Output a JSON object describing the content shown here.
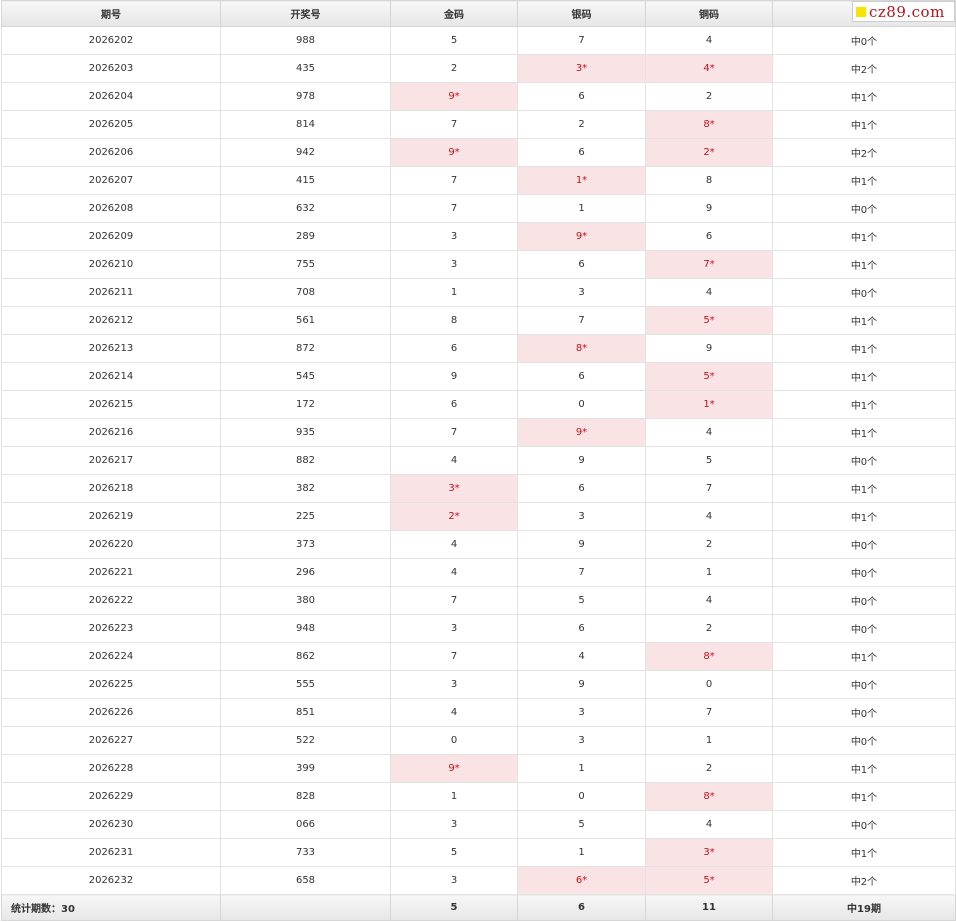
{
  "watermark": {
    "text": "cz89.com",
    "square_color": "#f4e600",
    "text_color": "#b3141d"
  },
  "colors": {
    "hit_background": "#f9e3e4",
    "hit_text": "#c0141e"
  },
  "table": {
    "headers": [
      "期号",
      "开奖号",
      "金码",
      "银码",
      "铜码",
      ""
    ],
    "rows": [
      {
        "issue": "2026202",
        "number": "988",
        "gold": "5",
        "silver": "7",
        "bronze": "4",
        "result": "中0个",
        "hits": []
      },
      {
        "issue": "2026203",
        "number": "435",
        "gold": "2",
        "silver": "3*",
        "bronze": "4*",
        "result": "中2个",
        "hits": [
          "silver",
          "bronze"
        ]
      },
      {
        "issue": "2026204",
        "number": "978",
        "gold": "9*",
        "silver": "6",
        "bronze": "2",
        "result": "中1个",
        "hits": [
          "gold"
        ]
      },
      {
        "issue": "2026205",
        "number": "814",
        "gold": "7",
        "silver": "2",
        "bronze": "8*",
        "result": "中1个",
        "hits": [
          "bronze"
        ]
      },
      {
        "issue": "2026206",
        "number": "942",
        "gold": "9*",
        "silver": "6",
        "bronze": "2*",
        "result": "中2个",
        "hits": [
          "gold",
          "bronze"
        ]
      },
      {
        "issue": "2026207",
        "number": "415",
        "gold": "7",
        "silver": "1*",
        "bronze": "8",
        "result": "中1个",
        "hits": [
          "silver"
        ]
      },
      {
        "issue": "2026208",
        "number": "632",
        "gold": "7",
        "silver": "1",
        "bronze": "9",
        "result": "中0个",
        "hits": []
      },
      {
        "issue": "2026209",
        "number": "289",
        "gold": "3",
        "silver": "9*",
        "bronze": "6",
        "result": "中1个",
        "hits": [
          "silver"
        ]
      },
      {
        "issue": "2026210",
        "number": "755",
        "gold": "3",
        "silver": "6",
        "bronze": "7*",
        "result": "中1个",
        "hits": [
          "bronze"
        ]
      },
      {
        "issue": "2026211",
        "number": "708",
        "gold": "1",
        "silver": "3",
        "bronze": "4",
        "result": "中0个",
        "hits": []
      },
      {
        "issue": "2026212",
        "number": "561",
        "gold": "8",
        "silver": "7",
        "bronze": "5*",
        "result": "中1个",
        "hits": [
          "bronze"
        ]
      },
      {
        "issue": "2026213",
        "number": "872",
        "gold": "6",
        "silver": "8*",
        "bronze": "9",
        "result": "中1个",
        "hits": [
          "silver"
        ]
      },
      {
        "issue": "2026214",
        "number": "545",
        "gold": "9",
        "silver": "6",
        "bronze": "5*",
        "result": "中1个",
        "hits": [
          "bronze"
        ]
      },
      {
        "issue": "2026215",
        "number": "172",
        "gold": "6",
        "silver": "0",
        "bronze": "1*",
        "result": "中1个",
        "hits": [
          "bronze"
        ]
      },
      {
        "issue": "2026216",
        "number": "935",
        "gold": "7",
        "silver": "9*",
        "bronze": "4",
        "result": "中1个",
        "hits": [
          "silver"
        ]
      },
      {
        "issue": "2026217",
        "number": "882",
        "gold": "4",
        "silver": "9",
        "bronze": "5",
        "result": "中0个",
        "hits": []
      },
      {
        "issue": "2026218",
        "number": "382",
        "gold": "3*",
        "silver": "6",
        "bronze": "7",
        "result": "中1个",
        "hits": [
          "gold"
        ]
      },
      {
        "issue": "2026219",
        "number": "225",
        "gold": "2*",
        "silver": "3",
        "bronze": "4",
        "result": "中1个",
        "hits": [
          "gold"
        ]
      },
      {
        "issue": "2026220",
        "number": "373",
        "gold": "4",
        "silver": "9",
        "bronze": "2",
        "result": "中0个",
        "hits": []
      },
      {
        "issue": "2026221",
        "number": "296",
        "gold": "4",
        "silver": "7",
        "bronze": "1",
        "result": "中0个",
        "hits": []
      },
      {
        "issue": "2026222",
        "number": "380",
        "gold": "7",
        "silver": "5",
        "bronze": "4",
        "result": "中0个",
        "hits": []
      },
      {
        "issue": "2026223",
        "number": "948",
        "gold": "3",
        "silver": "6",
        "bronze": "2",
        "result": "中0个",
        "hits": []
      },
      {
        "issue": "2026224",
        "number": "862",
        "gold": "7",
        "silver": "4",
        "bronze": "8*",
        "result": "中1个",
        "hits": [
          "bronze"
        ]
      },
      {
        "issue": "2026225",
        "number": "555",
        "gold": "3",
        "silver": "9",
        "bronze": "0",
        "result": "中0个",
        "hits": []
      },
      {
        "issue": "2026226",
        "number": "851",
        "gold": "4",
        "silver": "3",
        "bronze": "7",
        "result": "中0个",
        "hits": []
      },
      {
        "issue": "2026227",
        "number": "522",
        "gold": "0",
        "silver": "3",
        "bronze": "1",
        "result": "中0个",
        "hits": []
      },
      {
        "issue": "2026228",
        "number": "399",
        "gold": "9*",
        "silver": "1",
        "bronze": "2",
        "result": "中1个",
        "hits": [
          "gold"
        ]
      },
      {
        "issue": "2026229",
        "number": "828",
        "gold": "1",
        "silver": "0",
        "bronze": "8*",
        "result": "中1个",
        "hits": [
          "bronze"
        ]
      },
      {
        "issue": "2026230",
        "number": "066",
        "gold": "3",
        "silver": "5",
        "bronze": "4",
        "result": "中0个",
        "hits": []
      },
      {
        "issue": "2026231",
        "number": "733",
        "gold": "5",
        "silver": "1",
        "bronze": "3*",
        "result": "中1个",
        "hits": [
          "bronze"
        ]
      },
      {
        "issue": "2026232",
        "number": "658",
        "gold": "3",
        "silver": "6*",
        "bronze": "5*",
        "result": "中2个",
        "hits": [
          "silver",
          "bronze"
        ]
      }
    ],
    "footer": {
      "label": "统计期数：30",
      "number": "",
      "gold": "5",
      "silver": "6",
      "bronze": "11",
      "result": "中19期"
    }
  }
}
